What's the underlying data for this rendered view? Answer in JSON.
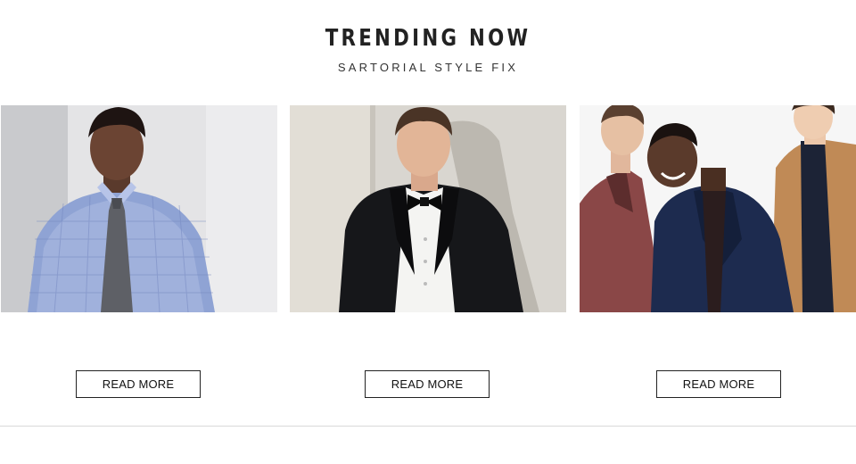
{
  "section": {
    "title": "TRENDING NOW",
    "subtitle": "SARTORIAL STYLE FIX"
  },
  "cards": [
    {
      "button_label": "READ MORE",
      "image": "man-in-check-shirt-and-tie"
    },
    {
      "button_label": "READ MORE",
      "image": "man-in-tuxedo-with-bow-tie"
    },
    {
      "button_label": "READ MORE",
      "image": "group-of-men-in-blazers"
    }
  ],
  "colors": {
    "text": "#222222",
    "button_border": "#222222",
    "divider": "#d9d9d9"
  }
}
